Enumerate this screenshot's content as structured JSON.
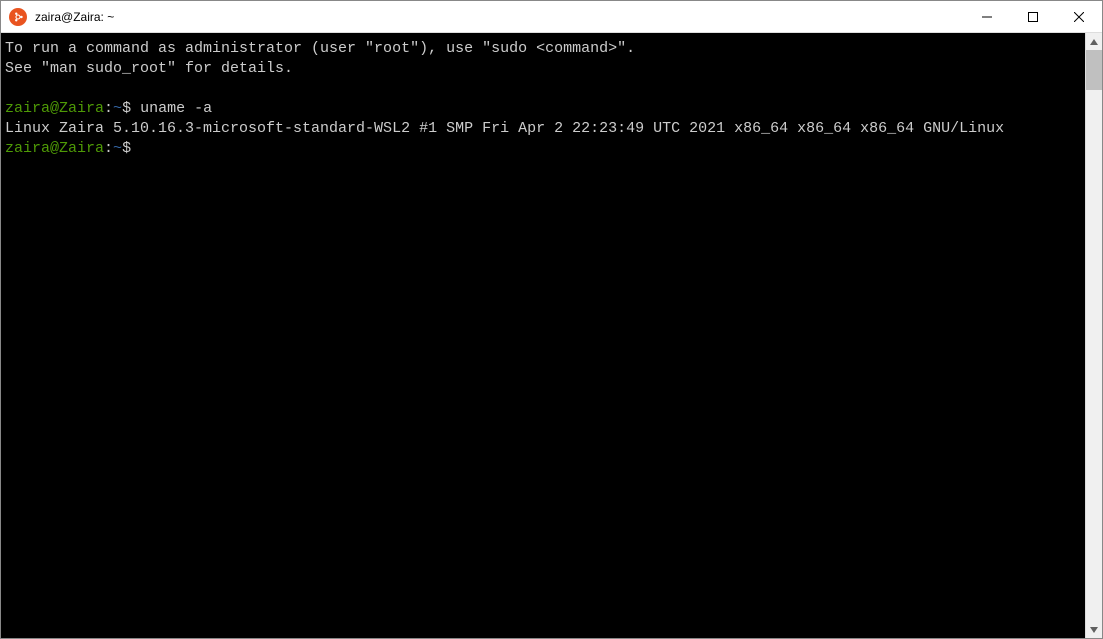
{
  "window": {
    "title": "zaira@Zaira: ~"
  },
  "terminal": {
    "motd_line1": "To run a command as administrator (user \"root\"), use \"sudo <command>\".",
    "motd_line2": "See \"man sudo_root\" for details.",
    "prompt1": {
      "user_host": "zaira@Zaira",
      "colon": ":",
      "path": "~",
      "dollar": "$",
      "command": "uname -a"
    },
    "output1": "Linux Zaira 5.10.16.3-microsoft-standard-WSL2 #1 SMP Fri Apr 2 22:23:49 UTC 2021 x86_64 x86_64 x86_64 GNU/Linux",
    "prompt2": {
      "user_host": "zaira@Zaira",
      "colon": ":",
      "path": "~",
      "dollar": "$"
    }
  }
}
